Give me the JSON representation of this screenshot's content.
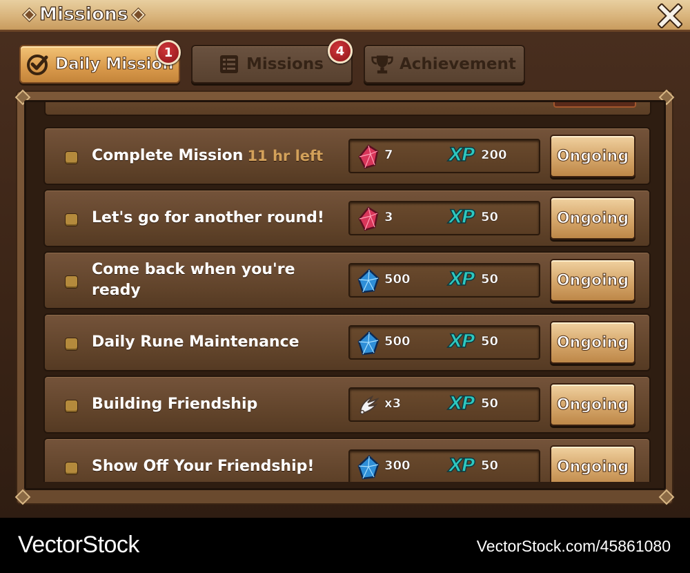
{
  "window": {
    "title": "Missions",
    "close_icon": "close-x-icon"
  },
  "tabs": [
    {
      "label": "Daily Mission",
      "icon": "checkmark-circle-icon",
      "badge": "1",
      "active": true
    },
    {
      "label": "Missions",
      "icon": "list-icon",
      "badge": "4",
      "active": false
    },
    {
      "label": "Achievement",
      "icon": "trophy-icon",
      "badge": null,
      "active": false
    }
  ],
  "missions": [
    {
      "title": "Complete Mission",
      "time_left": "11 hr left",
      "reward_icon": "red-crystal-icon",
      "reward_amount": "7",
      "xp_label": "XP",
      "xp_amount": "200",
      "status": "Ongoing"
    },
    {
      "title": "Let's go for another round!",
      "time_left": "",
      "reward_icon": "red-crystal-icon",
      "reward_amount": "3",
      "xp_label": "XP",
      "xp_amount": "50",
      "status": "Ongoing"
    },
    {
      "title": "Come back when you're ready",
      "time_left": "",
      "reward_icon": "blue-crystal-icon",
      "reward_amount": "500",
      "xp_label": "XP",
      "xp_amount": "50",
      "status": "Ongoing"
    },
    {
      "title": "Daily Rune Maintenance",
      "time_left": "",
      "reward_icon": "blue-crystal-icon",
      "reward_amount": "500",
      "xp_label": "XP",
      "xp_amount": "50",
      "status": "Ongoing"
    },
    {
      "title": "Building Friendship",
      "time_left": "",
      "reward_icon": "wing-icon",
      "reward_amount": "x3",
      "xp_label": "XP",
      "xp_amount": "50",
      "status": "Ongoing"
    },
    {
      "title": "Show Off Your Friendship!",
      "time_left": "",
      "reward_icon": "blue-crystal-icon",
      "reward_amount": "300",
      "xp_label": "XP",
      "xp_amount": "50",
      "status": "Ongoing"
    }
  ],
  "watermark": {
    "brand": "VectorStock",
    "id_text": "VectorStock.com/45861080"
  },
  "colors": {
    "xp_teal": "#2ec8c0",
    "time_left_gold": "#d3a15a",
    "badge_red": "#b3242a",
    "tab_active_orange": "#d99a4b"
  }
}
